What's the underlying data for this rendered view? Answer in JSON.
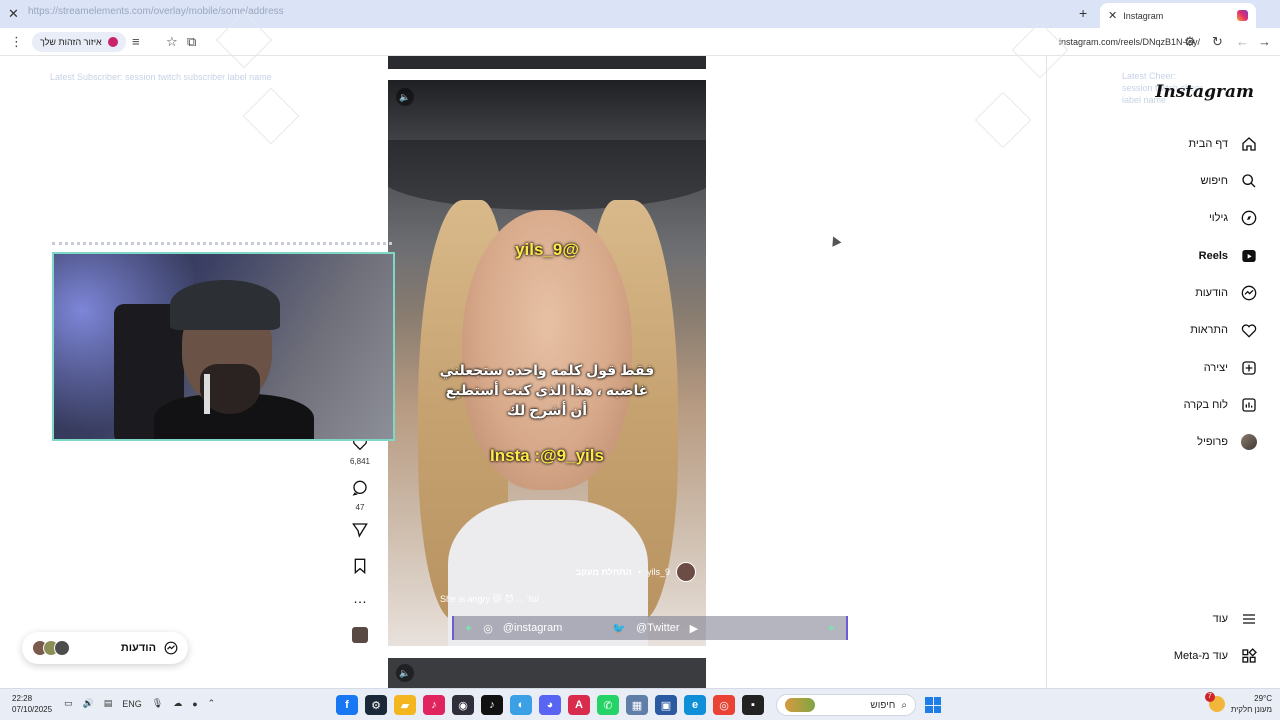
{
  "browser": {
    "tab_title": "Instagram",
    "tab_ghost_text": "https://streamelements.com/overlay/mobile/some/address",
    "profile_chip": "איזור הזהות שלך",
    "url": "instagram.com/reels/DNqzB1N-fey/"
  },
  "overlay_ghost": {
    "line1": "Latest Subscriber: session twitch subscriber label name",
    "right_block": [
      "Latest Cheer:",
      "session twitch cheer",
      "label name"
    ]
  },
  "sidebar": {
    "logo": "Instagram",
    "items": [
      {
        "label": "דף הבית",
        "icon": "home-icon"
      },
      {
        "label": "חיפוש",
        "icon": "search-icon"
      },
      {
        "label": "גילוי",
        "icon": "compass-icon"
      },
      {
        "label": "Reels",
        "icon": "reels-icon"
      },
      {
        "label": "הודעות",
        "icon": "messenger-icon"
      },
      {
        "label": "התראות",
        "icon": "heart-icon"
      },
      {
        "label": "יצירה",
        "icon": "plus-square-icon"
      },
      {
        "label": "לוח בקרה",
        "icon": "dashboard-icon"
      },
      {
        "label": "פרופיל",
        "icon": "profile-avatar"
      }
    ],
    "more": "עוד",
    "also_from_meta": "עוד מ-Meta"
  },
  "reel": {
    "handle_caption": "@9_yils",
    "arabic_caption": "فقط قول كلمه واحده ستجعلني غاضبه ، هذا الذي كنت أستطيع أن أشرح لك",
    "insta_caption": "Insta :@9_yils",
    "author": "9_yils",
    "follow_label": "התחלת מעקב",
    "description": "She is angry",
    "desc_more": "... עוד"
  },
  "actions": {
    "likes": "6,841",
    "comments": "47"
  },
  "ticker": {
    "instagram": "@instagram",
    "twitter": "@Twitter"
  },
  "messages_pill": {
    "label": "הודעות"
  },
  "taskbar": {
    "time": "22:28",
    "date": "07/10/2025",
    "lang": "ENG",
    "search_label": "חיפוש",
    "weather_temp": "29°C",
    "weather_desc": "מעונן חלקית",
    "notif_count": "7"
  }
}
